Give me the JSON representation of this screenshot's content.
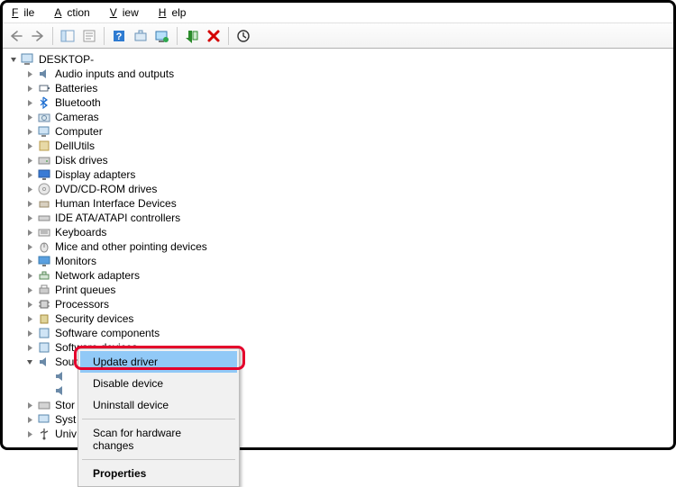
{
  "menubar": {
    "file": "File",
    "action": "Action",
    "view": "View",
    "help": "Help"
  },
  "root": "DESKTOP-",
  "categories": [
    "Audio inputs and outputs",
    "Batteries",
    "Bluetooth",
    "Cameras",
    "Computer",
    "DellUtils",
    "Disk drives",
    "Display adapters",
    "DVD/CD-ROM drives",
    "Human Interface Devices",
    "IDE ATA/ATAPI controllers",
    "Keyboards",
    "Mice and other pointing devices",
    "Monitors",
    "Network adapters",
    "Print queues",
    "Processors",
    "Security devices",
    "Software components",
    "Software devices",
    "Sound, video and game controllers"
  ],
  "truncated": {
    "stor": "Stor",
    "syst": "Syst",
    "univ": "Univ"
  },
  "ctx": {
    "update": "Update driver",
    "disable": "Disable device",
    "uninstall": "Uninstall device",
    "scan": "Scan for hardware changes",
    "properties": "Properties"
  }
}
